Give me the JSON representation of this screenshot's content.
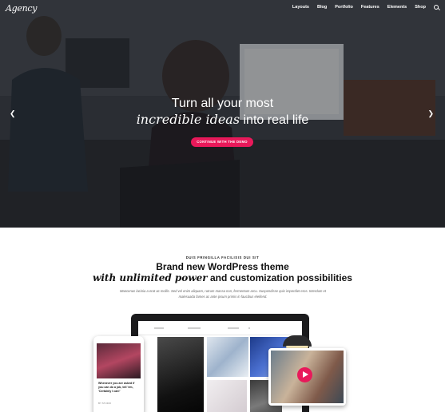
{
  "header": {
    "logo": "Agency",
    "menu": [
      "Layouts",
      "Blog",
      "Portfolio",
      "Features",
      "Elements",
      "Shop"
    ],
    "search_icon": "search-icon"
  },
  "hero": {
    "line1": "Turn all your most",
    "line2_italic": "incredible ideas",
    "line2_rest": " into real life",
    "cta": "CONTINUE WITH THE DEMO",
    "prev_icon": "chevron-left-icon",
    "next_icon": "chevron-right-icon"
  },
  "intro": {
    "eyebrow": "DUIS FRINGILLA FACILISIS DUI SIT",
    "heading1": "Brand new WordPress theme",
    "heading2_italic": "with unlimited power",
    "heading2_rest": " and customization possibilities",
    "paragraph": "Maecenas lacinia a erat ac mollis. Sed vel enim aliquam, rutrum massa non, fermentum arcu. Suspendisse quis imperdiet eros. Interdum et malesuada fames ac ante ipsum primis in faucibus eleifend."
  },
  "phone": {
    "post_title": "Whenever you are asked if you can do a job, tell 'em, 'Certainly I can!'",
    "meta": "BY STUDIO"
  },
  "colors": {
    "accent": "#e8195a",
    "dark": "#1b1b1d"
  }
}
